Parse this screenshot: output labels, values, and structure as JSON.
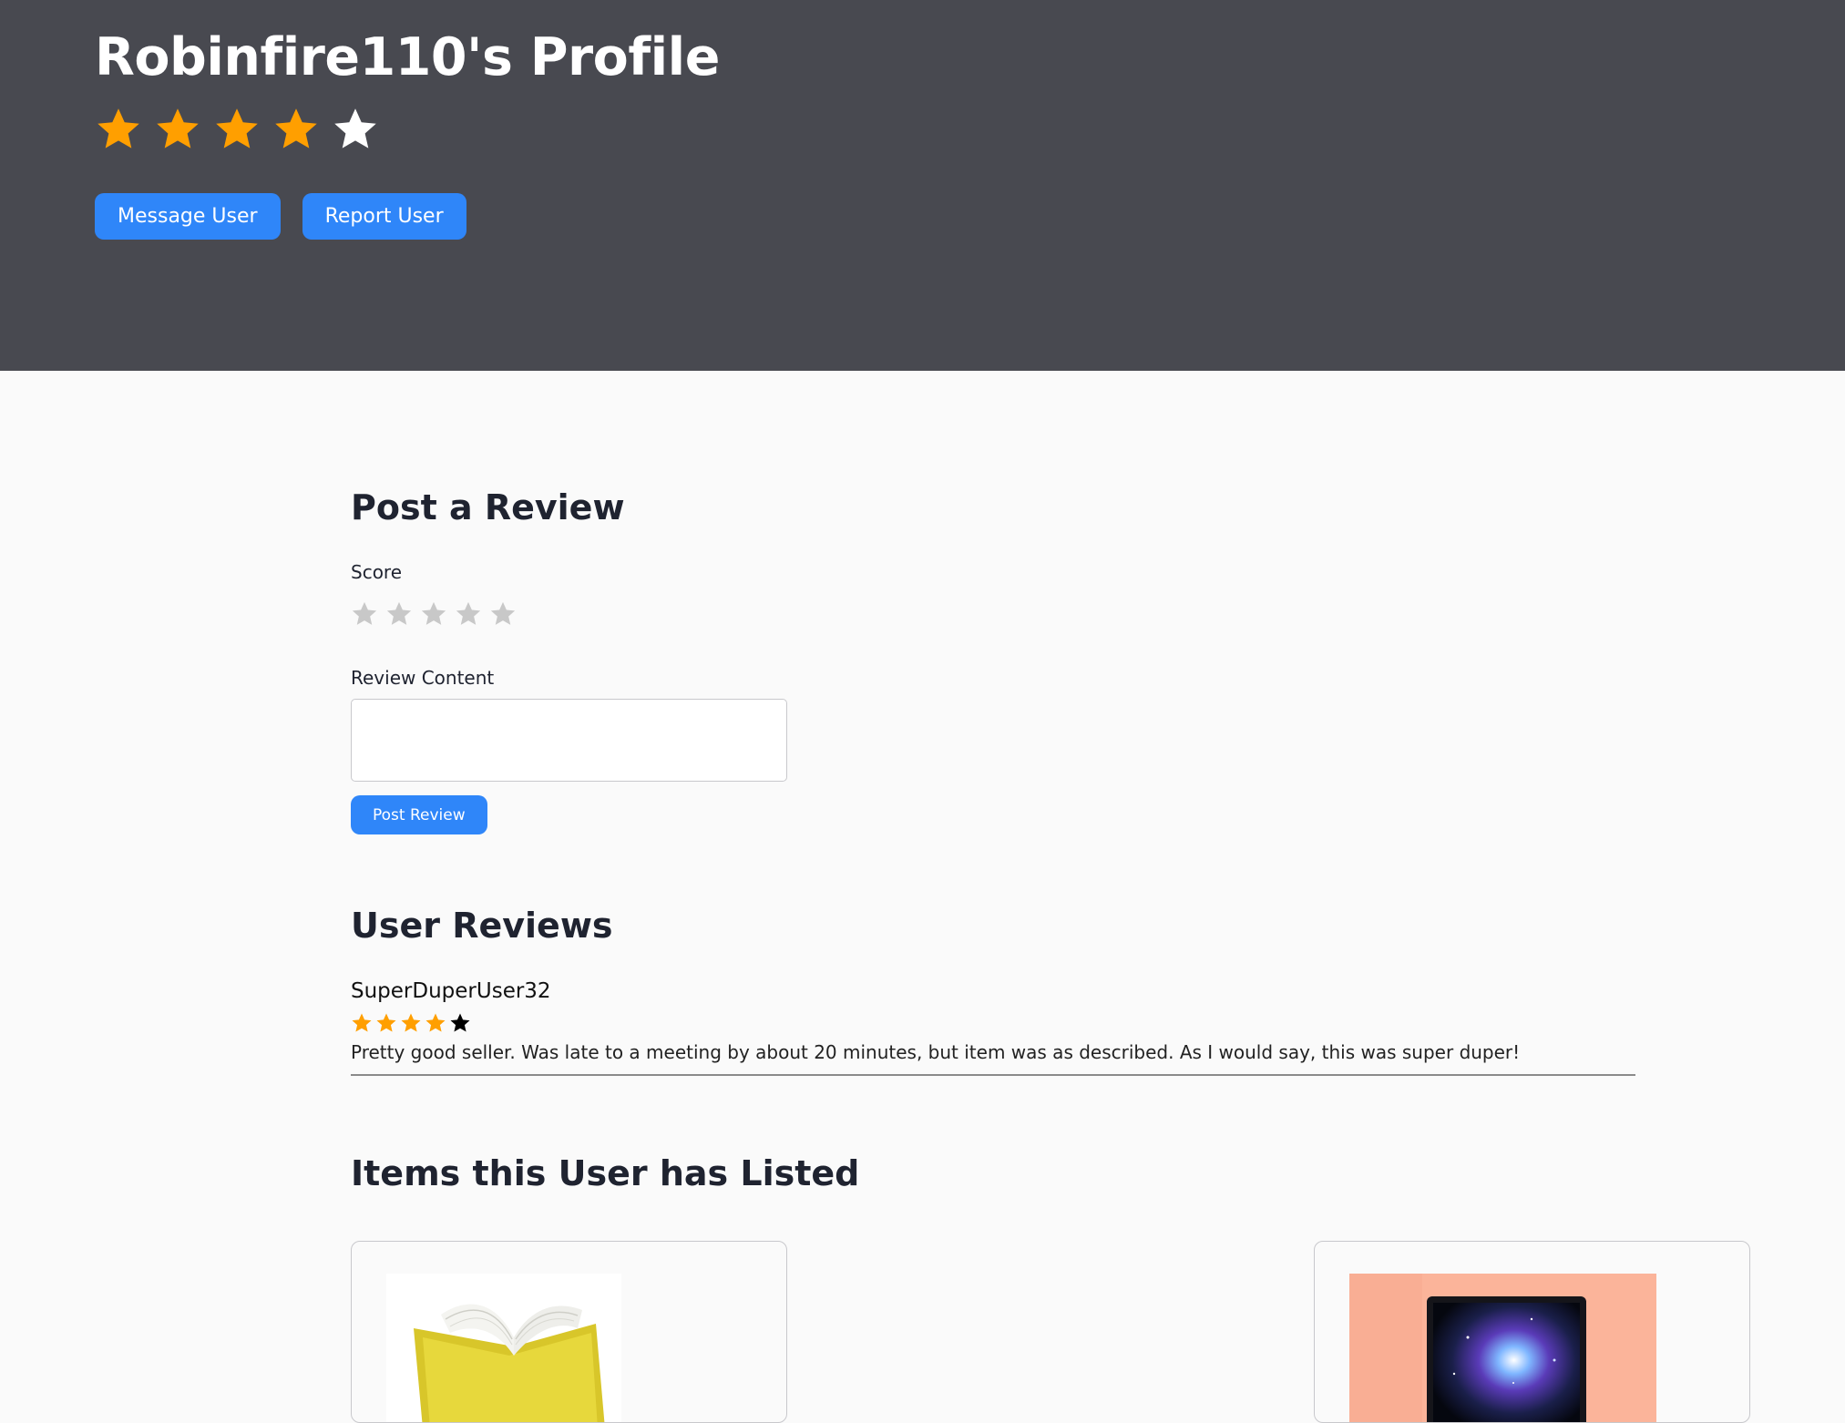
{
  "profile": {
    "title": "Robinfire110's Profile",
    "rating": 4,
    "rating_max": 5,
    "buttons": {
      "message": "Message User",
      "report": "Report User"
    }
  },
  "post_review": {
    "heading": "Post a Review",
    "score_label": "Score",
    "score_value": 0,
    "score_max": 5,
    "content_label": "Review Content",
    "content_value": "",
    "submit_label": "Post Review"
  },
  "user_reviews": {
    "heading": "User Reviews",
    "items": [
      {
        "author": "SuperDuperUser32",
        "rating": 4,
        "rating_max": 5,
        "text": "Pretty good seller. Was late to a meeting by about 20 minutes, but item was as described. As I would say, this was super duper!"
      }
    ]
  },
  "listed_items": {
    "heading": "Items this User has Listed",
    "items": [
      {
        "image": "yellow-book-photo"
      },
      {
        "image": "laptop-galaxy-photo"
      }
    ]
  },
  "colors": {
    "hero_bg": "#484950",
    "accent": "#2f86f9",
    "star_filled": "#ff9f00",
    "star_empty_hero": "#ffffff",
    "star_empty_form": "#c8c8c8",
    "star_empty_review": "#000000"
  }
}
